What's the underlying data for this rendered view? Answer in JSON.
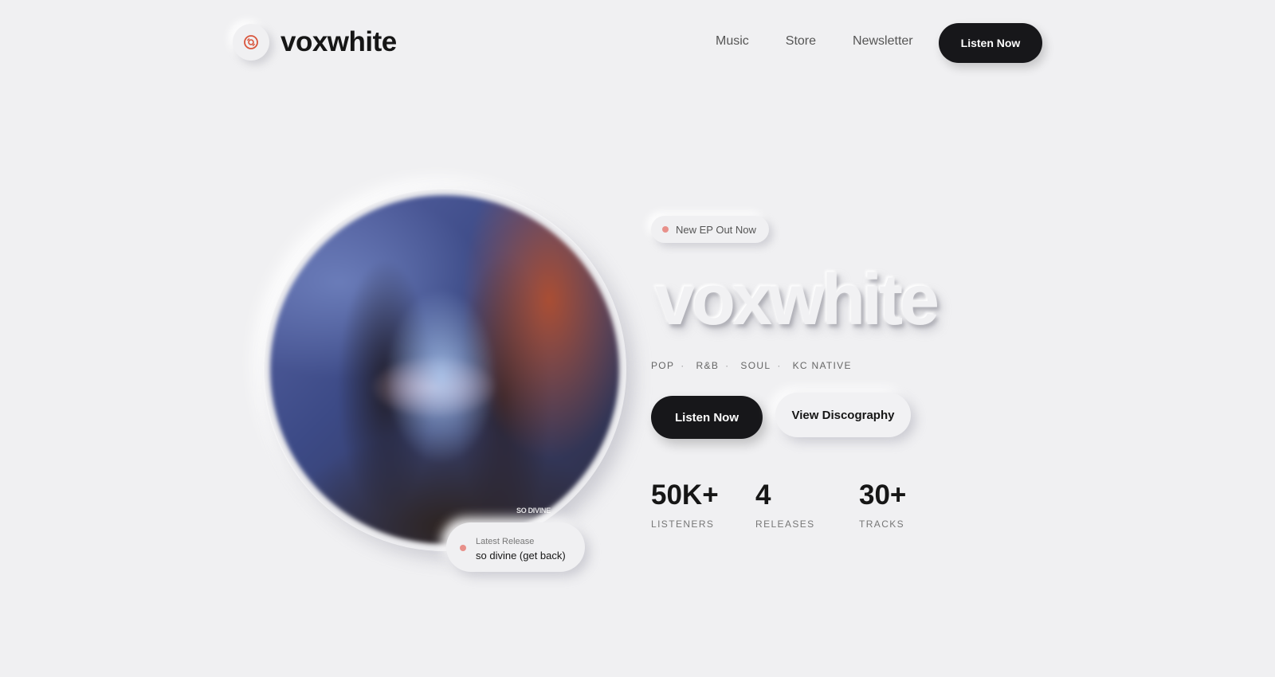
{
  "brand": {
    "name": "voxwhite",
    "icon": "record-disc-icon",
    "accent": "#d9553c"
  },
  "nav": {
    "links": [
      "Music",
      "Store",
      "Newsletter"
    ],
    "cta": "Listen Now"
  },
  "hero": {
    "badge": "New EP Out Now",
    "title": "voxwhite",
    "genres": [
      "POP",
      "R&B",
      "SOUL",
      "KC NATIVE"
    ],
    "separator": "·",
    "primary_button": "Listen Now",
    "secondary_button": "View Discography",
    "art_caption": "SO DIVINE",
    "latest": {
      "label": "Latest Release",
      "title": "so divine (get back)"
    },
    "stats": [
      {
        "value": "50K+",
        "label": "LISTENERS"
      },
      {
        "value": "4",
        "label": "RELEASES"
      },
      {
        "value": "30+",
        "label": "TRACKS"
      }
    ]
  },
  "colors": {
    "background": "#f0f0f2",
    "dark": "#17171a",
    "dot": "#e8908a"
  }
}
